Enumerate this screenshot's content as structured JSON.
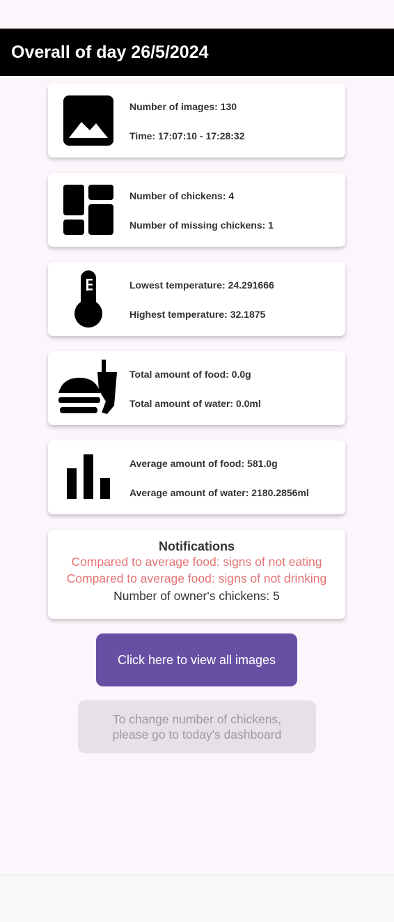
{
  "header": {
    "title": "Overall of day 26/5/2024"
  },
  "cards": [
    {
      "icon": "image-icon",
      "line1": "Number of images: 130",
      "line2": "Time: 17:07:10 - 17:28:32"
    },
    {
      "icon": "dashboard-icon",
      "line1": "Number of chickens: 4",
      "line2": "Number of missing chickens: 1"
    },
    {
      "icon": "thermometer-icon",
      "line1": "Lowest temperature: 24.291666",
      "line2": "Highest temperature: 32.1875"
    },
    {
      "icon": "fastfood-icon",
      "line1": "Total amount of food: 0.0g",
      "line2": "Total amount of water: 0.0ml"
    },
    {
      "icon": "bar-chart-icon",
      "line1": "Average amount of food: 581.0g",
      "line2": "Average amount of water: 2180.2856ml"
    }
  ],
  "notifications": {
    "title": "Notifications",
    "warning_food": "Compared to average food: signs of not eating",
    "warning_water": "Compared to average food: signs of not drinking",
    "owner_count": "Number of owner's chickens: 5",
    "warning_color": "#e57373"
  },
  "buttons": {
    "view_images": "Click here to view all images",
    "change_chickens": "To change number of chickens, please go to today's dashboard"
  },
  "colors": {
    "primary": "#6750a4",
    "header_bg": "#000000",
    "background": "#fcf6fc"
  }
}
